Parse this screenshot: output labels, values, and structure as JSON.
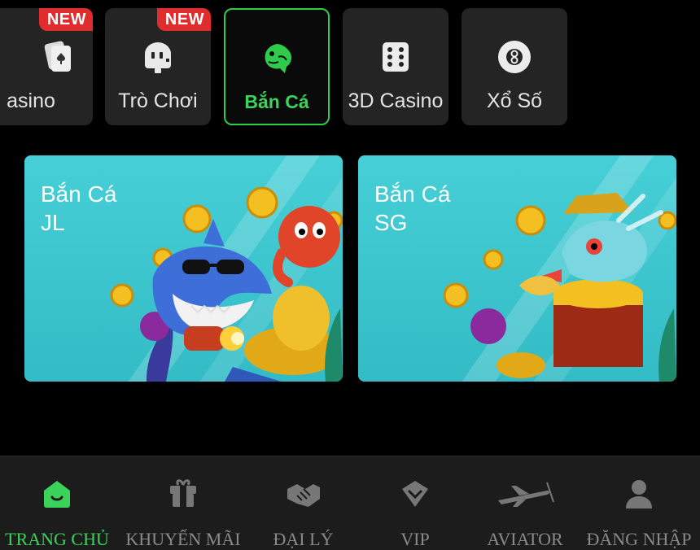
{
  "categories": [
    {
      "label": "asino",
      "icon": "cards-icon",
      "badge": "NEW"
    },
    {
      "label": "Trò Chơi",
      "icon": "robot-icon",
      "badge": "NEW"
    },
    {
      "label": "Bắn Cá",
      "icon": "fish-icon",
      "active": true
    },
    {
      "label": "3D Casino",
      "icon": "dice-icon"
    },
    {
      "label": "Xổ Số",
      "icon": "lottery-ball-icon"
    }
  ],
  "games": [
    {
      "title": "Bắn Cá\nJL"
    },
    {
      "title": "Bắn Cá\nSG"
    }
  ],
  "nav": [
    {
      "label": "TRANG CHỦ",
      "icon": "home-icon",
      "active": true
    },
    {
      "label": "KHUYẾN MÃI",
      "icon": "gift-icon"
    },
    {
      "label": "ĐẠI LÝ",
      "icon": "handshake-icon"
    },
    {
      "label": "VIP",
      "icon": "diamond-icon"
    },
    {
      "label": "AVIATOR",
      "icon": "airplane-icon"
    },
    {
      "label": "ĐĂNG NHẬP",
      "icon": "user-icon"
    }
  ],
  "colors": {
    "accent": "#3bd35a",
    "badge": "#e02c2c",
    "card_bg": "#3ec7cf"
  }
}
